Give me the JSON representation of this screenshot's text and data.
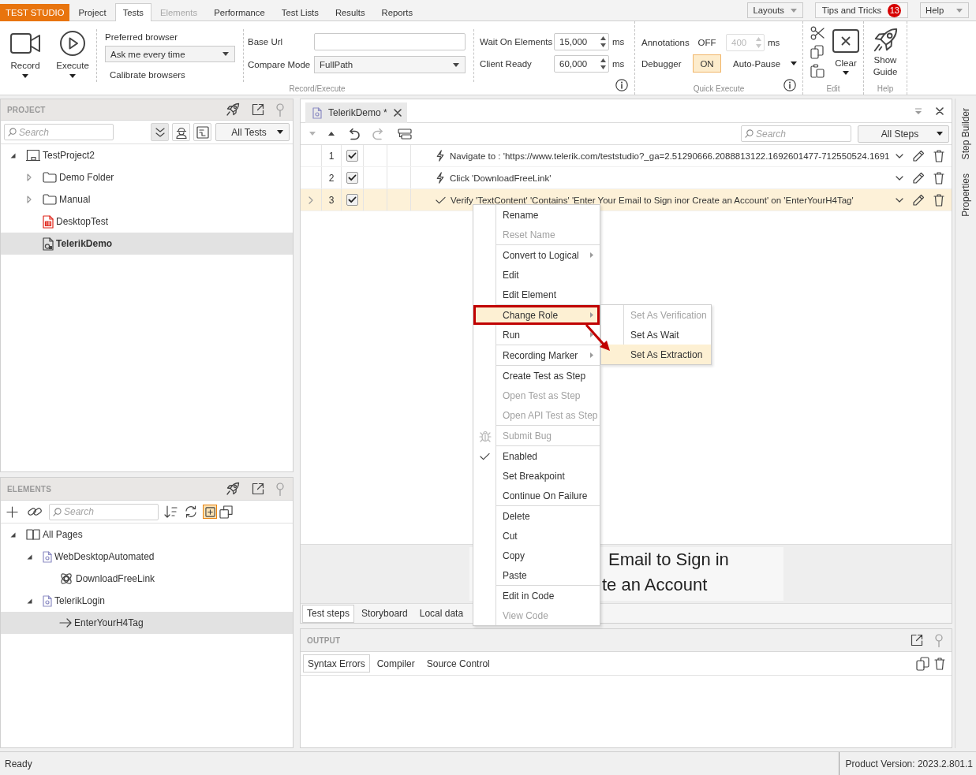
{
  "app_bar": {
    "brand": "TEST STUDIO",
    "tabs": [
      {
        "label": "Project",
        "selected": false,
        "disabled": false
      },
      {
        "label": "Tests",
        "selected": true,
        "disabled": false
      },
      {
        "label": "Elements",
        "selected": false,
        "disabled": true
      },
      {
        "label": "Performance",
        "selected": false,
        "disabled": false
      },
      {
        "label": "Test Lists",
        "selected": false,
        "disabled": false
      },
      {
        "label": "Results",
        "selected": false,
        "disabled": false
      },
      {
        "label": "Reports",
        "selected": false,
        "disabled": false
      }
    ],
    "buttons": [
      {
        "label": "Layouts",
        "kind": "dropdown"
      },
      {
        "label": "Tips and Tricks",
        "kind": "counter",
        "badge": "13"
      },
      {
        "label": "Help",
        "kind": "dropdown"
      }
    ]
  },
  "ribbon": {
    "record_execute": {
      "label": "Record/Execute",
      "run_buttons": [
        {
          "label": "Record",
          "kind": "record"
        },
        {
          "label": "Execute",
          "kind": "execute"
        }
      ],
      "preferred_browser": {
        "label": "Preferred browser",
        "value": "Ask me every time"
      },
      "calibrate": "Calibrate browsers",
      "base_url": {
        "label": "Base Url"
      },
      "compare_mode": {
        "label": "Compare Mode",
        "value": "FullPath"
      },
      "timeouts": [
        {
          "label": "Wait On Elements",
          "value": "15,000",
          "unit": "ms"
        },
        {
          "label": "Client Ready",
          "value": "60,000",
          "unit": "ms"
        }
      ]
    },
    "quick_execute": {
      "label": "Quick Execute",
      "annotations": {
        "label": "Annotations",
        "toggle": "OFF",
        "on": false,
        "delay": "400",
        "unit": "ms",
        "disabled": true
      },
      "debugger": {
        "label": "Debugger",
        "toggle": "ON",
        "on": true,
        "mode": "Auto-Pause"
      }
    },
    "edit": {
      "label": "Edit",
      "clear": "Clear"
    },
    "help": {
      "label": "Help",
      "guide": "Show Guide"
    }
  },
  "project": {
    "title": "PROJECT",
    "search": {
      "placeholder": "Search"
    },
    "filter": "All Tests",
    "tree": [
      {
        "label": "TestProject2",
        "kind": "project",
        "expanded": true,
        "selected": false,
        "open": false,
        "children": [
          {
            "label": "Demo Folder",
            "kind": "folder",
            "expanded": false,
            "selected": false,
            "open": false
          },
          {
            "label": "Manual",
            "kind": "folder",
            "expanded": false,
            "selected": false,
            "open": false
          },
          {
            "label": "DesktopTest",
            "kind": "desktop-test",
            "selected": false,
            "open": false
          },
          {
            "label": "TelerikDemo",
            "kind": "web-test",
            "selected": true,
            "open": true
          }
        ]
      }
    ]
  },
  "elements": {
    "title": "ELEMENTS",
    "search": {
      "placeholder": "Search"
    },
    "highlight_on": true,
    "tree": [
      {
        "label": "All Pages",
        "kind": "pages",
        "expanded": true,
        "selected": false,
        "children": [
          {
            "label": "WebDesktopAutomated",
            "kind": "page",
            "expanded": true,
            "selected": false,
            "children": [
              {
                "label": "DownloadFreeLink",
                "kind": "element",
                "selected": false
              }
            ]
          },
          {
            "label": "TelerikLogin",
            "kind": "page",
            "expanded": true,
            "selected": false,
            "children": [
              {
                "label": "EnterYourH4Tag",
                "kind": "target",
                "selected": true
              }
            ]
          }
        ]
      }
    ]
  },
  "document_tab": {
    "title": "TelerikDemo *"
  },
  "steps_toolbar": {
    "buttons": [
      {
        "kind": "move-down",
        "disabled": true
      },
      {
        "kind": "move-up",
        "disabled": false
      },
      {
        "kind": "undo",
        "disabled": false
      },
      {
        "kind": "redo",
        "disabled": true
      },
      {
        "kind": "step-builder",
        "disabled": false
      }
    ],
    "search": {
      "placeholder": "Search"
    },
    "filter": "All Steps"
  },
  "steps": [
    {
      "number": "1",
      "enabled": true,
      "kind": "action",
      "description": "Navigate to : 'https://www.telerik.com/teststudio?_ga=2.51290666.2088813122.1692601477-712550524.1691",
      "selected": false
    },
    {
      "number": "2",
      "enabled": true,
      "kind": "action",
      "description": "Click 'DownloadFreeLink'",
      "selected": false
    },
    {
      "number": "3",
      "enabled": true,
      "kind": "verification",
      "description": "Verify 'TextContent' 'Contains' 'Enter Your Email to Sign inor Create an Account' on 'EnterYourH4Tag'",
      "selected": true
    }
  ],
  "preview": {
    "lines": [
      "Email to Sign in",
      "te an Account"
    ]
  },
  "view_tabs": [
    {
      "label": "Test steps",
      "selected": true
    },
    {
      "label": "Storyboard",
      "selected": false
    },
    {
      "label": "Local data",
      "selected": false
    }
  ],
  "output": {
    "title": "OUTPUT",
    "tabs": [
      {
        "label": "Syntax Errors",
        "selected": true
      },
      {
        "label": "Compiler",
        "selected": false
      },
      {
        "label": "Source Control",
        "selected": false
      }
    ]
  },
  "side_tabs": [
    {
      "label": "Step Builder"
    },
    {
      "label": "Properties"
    }
  ],
  "context_menu": {
    "groups": [
      [
        {
          "label": "Rename",
          "kind": "action",
          "disabled": false,
          "checked": false,
          "selected": false
        },
        {
          "label": "Reset Name",
          "kind": "action",
          "disabled": true,
          "checked": false,
          "selected": false
        }
      ],
      [
        {
          "label": "Convert to Logical",
          "kind": "submenu",
          "disabled": false,
          "checked": false,
          "selected": false
        },
        {
          "label": "Edit",
          "kind": "action",
          "disabled": false,
          "checked": false,
          "selected": false
        },
        {
          "label": "Edit Element",
          "kind": "action",
          "disabled": false,
          "checked": false,
          "selected": false
        }
      ],
      [
        {
          "label": "Change Role",
          "kind": "submenu",
          "disabled": false,
          "checked": false,
          "selected": true
        },
        {
          "label": "Run",
          "kind": "submenu",
          "disabled": false,
          "checked": false,
          "selected": false
        }
      ],
      [
        {
          "label": "Recording Marker",
          "kind": "submenu",
          "disabled": false,
          "checked": false,
          "selected": false
        }
      ],
      [
        {
          "label": "Create Test as Step",
          "kind": "action",
          "disabled": false,
          "checked": false,
          "selected": false
        },
        {
          "label": "Open Test as Step",
          "kind": "action",
          "disabled": true,
          "checked": false,
          "selected": false
        },
        {
          "label": "Open API Test as Step",
          "kind": "action",
          "disabled": true,
          "checked": false,
          "selected": false
        }
      ],
      [
        {
          "label": "Submit Bug",
          "kind": "bug",
          "disabled": true,
          "checked": false,
          "selected": false
        }
      ],
      [
        {
          "label": "Enabled",
          "kind": "action",
          "disabled": false,
          "checked": true,
          "selected": false
        },
        {
          "label": "Set Breakpoint",
          "kind": "action",
          "disabled": false,
          "checked": false,
          "selected": false
        },
        {
          "label": "Continue On Failure",
          "kind": "action",
          "disabled": false,
          "checked": false,
          "selected": false
        }
      ],
      [
        {
          "label": "Delete",
          "kind": "action",
          "disabled": false,
          "checked": false,
          "selected": false
        },
        {
          "label": "Cut",
          "kind": "action",
          "disabled": false,
          "checked": false,
          "selected": false
        },
        {
          "label": "Copy",
          "kind": "action",
          "disabled": false,
          "checked": false,
          "selected": false
        },
        {
          "label": "Paste",
          "kind": "action",
          "disabled": false,
          "checked": false,
          "selected": false
        }
      ],
      [
        {
          "label": "Edit in Code",
          "kind": "action",
          "disabled": false,
          "checked": false,
          "selected": false
        },
        {
          "label": "View Code",
          "kind": "action",
          "disabled": true,
          "checked": false,
          "selected": false
        }
      ]
    ],
    "submenu": [
      {
        "label": "Set As Verification",
        "disabled": true,
        "selected": false
      },
      {
        "label": "Set As Wait",
        "disabled": false,
        "selected": false
      },
      {
        "label": "Set As Extraction",
        "disabled": false,
        "selected": true
      }
    ]
  },
  "status_bar": {
    "status": "Ready",
    "version": "Product Version: 2023.2.801.1"
  }
}
